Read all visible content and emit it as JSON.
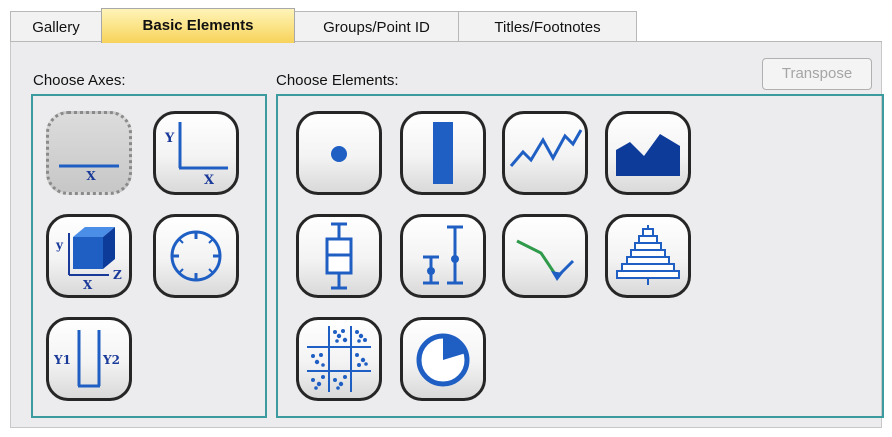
{
  "tabs": [
    {
      "label": "Gallery",
      "active": false
    },
    {
      "label": "Basic Elements",
      "active": true
    },
    {
      "label": "Groups/Point ID",
      "active": false
    },
    {
      "label": "Titles/Footnotes",
      "active": false
    }
  ],
  "axes_section": {
    "label": "Choose Axes:",
    "items": [
      {
        "name": "1-d axis",
        "icon": "one-d-axis-icon",
        "selected": true,
        "x_label": "X"
      },
      {
        "name": "2-d axes",
        "icon": "two-d-axes-icon",
        "y_label": "Y",
        "x_label": "X"
      },
      {
        "name": "3-d axes",
        "icon": "three-d-axes-icon",
        "y_label": "y",
        "x_label": "X",
        "z_label": "Z"
      },
      {
        "name": "polar axis",
        "icon": "polar-axis-icon"
      },
      {
        "name": "dual y axes",
        "icon": "dual-y-axes-icon",
        "y1_label": "Y1",
        "y2_label": "Y2"
      }
    ]
  },
  "elements_section": {
    "label": "Choose Elements:",
    "transpose_label": "Transpose",
    "transpose_enabled": false,
    "items": [
      {
        "name": "point",
        "icon": "point-icon"
      },
      {
        "name": "interval",
        "icon": "interval-bar-icon"
      },
      {
        "name": "line",
        "icon": "line-icon"
      },
      {
        "name": "area",
        "icon": "area-icon"
      },
      {
        "name": "boxplot",
        "icon": "boxplot-icon"
      },
      {
        "name": "high-low",
        "icon": "high-low-icon"
      },
      {
        "name": "path",
        "icon": "path-icon"
      },
      {
        "name": "histogram pyramid",
        "icon": "pyramid-icon"
      },
      {
        "name": "scatterplot matrix",
        "icon": "scatterplot-matrix-icon"
      },
      {
        "name": "pie",
        "icon": "pie-icon"
      }
    ]
  },
  "colors": {
    "accent_teal": "#3c9b9f",
    "icon_blue": "#1f5fc4",
    "active_tab": "#f7d35a"
  }
}
